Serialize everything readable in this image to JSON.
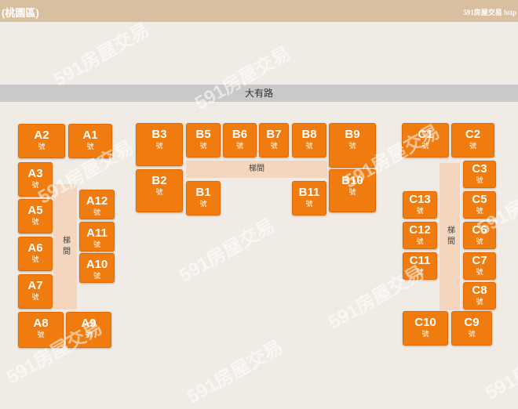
{
  "header": {
    "title": "(桃園區)",
    "brand": "591房屋交易 http"
  },
  "road": {
    "label": "大有路"
  },
  "stairs_label": "梯間",
  "stall_suffix": "號",
  "stalls": [
    "A1",
    "A2",
    "A3",
    "A5",
    "A6",
    "A7",
    "A8",
    "A9",
    "A10",
    "A11",
    "A12",
    "B1",
    "B2",
    "B3",
    "B5",
    "B6",
    "B7",
    "B8",
    "B9",
    "B10",
    "B11",
    "C1",
    "C2",
    "C3",
    "C5",
    "C6",
    "C7",
    "C8",
    "C9",
    "C10",
    "C11",
    "C12",
    "C13"
  ],
  "watermark": "591房屋交易"
}
